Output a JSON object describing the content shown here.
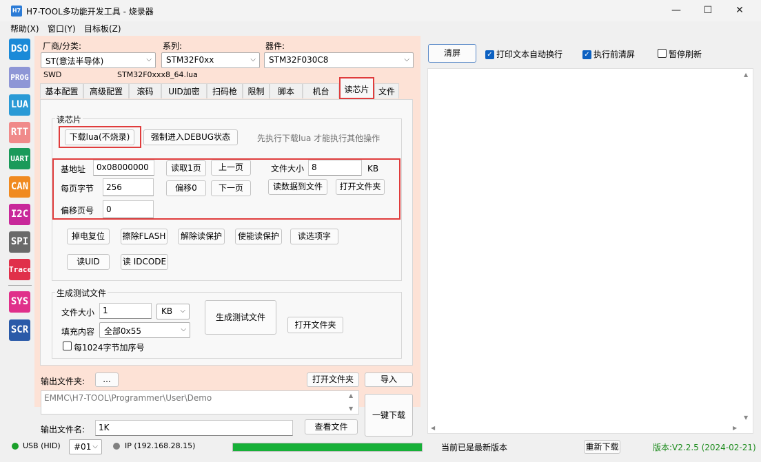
{
  "window": {
    "title": "H7-TOOL多功能开发工具 - 烧录器",
    "logo": "H7",
    "minimize": "—",
    "maximize": "☐",
    "close": "✕"
  },
  "menu": [
    "帮助(X)",
    "窗口(Y)",
    "目标板(Z)"
  ],
  "tools": [
    {
      "label": "DSO",
      "color": "#1a8ad8"
    },
    {
      "label": "PROG",
      "color": "#8e96d6"
    },
    {
      "label": "LUA",
      "color": "#2a9ad6"
    },
    {
      "label": "RTT",
      "color": "#f08a8a"
    },
    {
      "label": "UART",
      "color": "#1a9a5a"
    },
    {
      "label": "CAN",
      "color": "#f08a20"
    },
    {
      "label": "I2C",
      "color": "#c8289a"
    },
    {
      "label": "SPI",
      "color": "#6a6a6a"
    },
    {
      "label": "Trace",
      "color": "#e0304a"
    },
    {
      "label": "SYS",
      "color": "#e0308a"
    },
    {
      "label": "SCR",
      "color": "#2a5aa8"
    }
  ],
  "selectors": {
    "vendor_label": "厂商/分类:",
    "vendor_value": "ST(意法半导体)",
    "series_label": "系列:",
    "series_value": "STM32F0xx",
    "device_label": "器件:",
    "device_value": "STM32F030C8",
    "interface": "SWD",
    "lua_file": "STM32F0xxx8_64.lua"
  },
  "tabs": [
    "基本配置",
    "高级配置",
    "滚码",
    "UID加密",
    "扫码枪",
    "限制",
    "脚本",
    "机台",
    "读芯片",
    "文件"
  ],
  "read_chip": {
    "group_title": "读芯片",
    "download_lua": "下载lua(不烧录)",
    "force_debug": "强制进入DEBUG状态",
    "hint": "先执行下载lua 才能执行其他操作",
    "base_addr_label": "基地址",
    "base_addr": "0x08000000",
    "read_page": "读取1页",
    "prev_page": "上一页",
    "file_size_label": "文件大小",
    "file_size": "8",
    "file_size_unit": "KB",
    "page_bytes_label": "每页字节",
    "page_bytes": "256",
    "offset0": "偏移0",
    "next_page": "下一页",
    "read_to_file": "读数据到文件",
    "open_folder": "打开文件夹",
    "offset_page_label": "偏移页号",
    "offset_page": "0",
    "btn_power_reset": "掉电复位",
    "btn_erase_flash": "擦除FLASH",
    "btn_unprotect": "解除读保护",
    "btn_protect": "使能读保护",
    "btn_read_option": "读选项字",
    "btn_read_uid": "读UID",
    "btn_read_idcode": "读 IDCODE"
  },
  "gen_test": {
    "group_title": "生成测试文件",
    "size_label": "文件大小",
    "size_value": "1",
    "size_unit": "KB",
    "fill_label": "填充内容",
    "fill_value": "全部0x55",
    "seq_label": "每1024字节加序号",
    "gen_btn": "生成测试文件",
    "open_folder": "打开文件夹"
  },
  "output": {
    "folder_label": "输出文件夹:",
    "browse": "...",
    "open_folder": "打开文件夹",
    "import": "导入",
    "path": "EMMC\\H7-TOOL\\Programmer\\User\\Demo",
    "one_click": "一键下载",
    "name_label": "输出文件名:",
    "name_value": "1K",
    "view_file": "查看文件"
  },
  "right": {
    "clear": "清屏",
    "wrap_label": "打印文本自动换行",
    "wrap_checked": true,
    "clear_before_label": "执行前清屏",
    "clear_before_checked": true,
    "pause_label": "暂停刷新",
    "pause_checked": false
  },
  "status": {
    "usb": "USB (HID)",
    "port": "#01",
    "ip": "IP (192.168.28.15)",
    "progress": 1.0,
    "version_msg": "当前已是最新版本",
    "redownload": "重新下载",
    "version": "版本:V2.2.5 (2024-02-21)",
    "usb_color": "#1aa02a",
    "ip_color": "#808080",
    "progress_color": "#17b038",
    "version_color": "#1a8a1a"
  }
}
